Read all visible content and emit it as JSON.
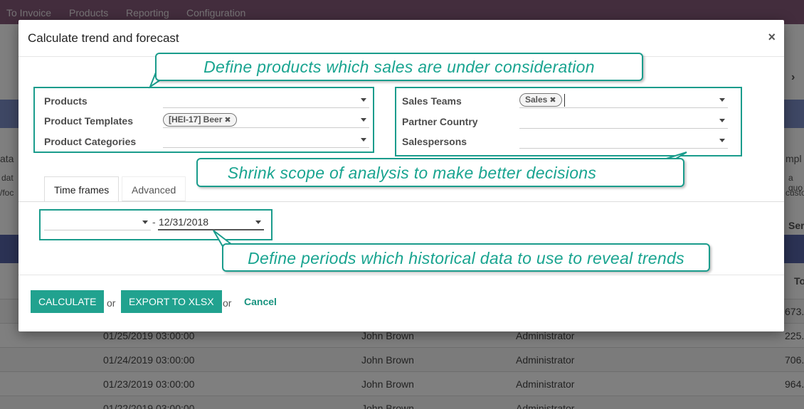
{
  "topbar": {
    "menu": [
      "To Invoice",
      "Products",
      "Reporting",
      "Configuration"
    ]
  },
  "background": {
    "left_side": [
      "ata",
      "dat",
      "/foc"
    ],
    "right_side": [
      "mpl",
      "a quo",
      "custo",
      "Ser",
      "To"
    ],
    "rows": [
      {
        "date": "",
        "customer": "",
        "user": "",
        "amount": "673."
      },
      {
        "date": "01/25/2019 03:00:00",
        "customer": "John Brown",
        "user": "Administrator",
        "amount": "225."
      },
      {
        "date": "01/24/2019 03:00:00",
        "customer": "John Brown",
        "user": "Administrator",
        "amount": "706."
      },
      {
        "date": "01/23/2019 03:00:00",
        "customer": "John Brown",
        "user": "Administrator",
        "amount": "964."
      },
      {
        "date": "01/22/2019 03:00:00",
        "customer": "John Brown",
        "user": "Administrator",
        "amount": ""
      }
    ]
  },
  "modal": {
    "title": "Calculate trend and forecast",
    "close": "×",
    "left_fields": {
      "products_label": "Products",
      "templates_label": "Product Templates",
      "templates_tag": "[HEI-17] Beer",
      "categories_label": "Product Categories"
    },
    "right_fields": {
      "teams_label": "Sales Teams",
      "teams_tag": "Sales",
      "country_label": "Partner Country",
      "salespersons_label": "Salespersons"
    },
    "tabs": {
      "time_frames": "Time frames",
      "advanced": "Advanced"
    },
    "dates": {
      "separator": "-",
      "date_to": "12/31/2018"
    },
    "footer": {
      "calculate": "CALCULATE",
      "or1": "or",
      "export": "EXPORT TO XLSX",
      "or2": "or",
      "cancel": "Cancel"
    }
  },
  "callouts": {
    "products": "Define products which sales are under consideration",
    "scope": "Shrink scope of analysis to make better decisions",
    "periods": "Define periods which historical data to use to reveal trends"
  },
  "colors": {
    "accent": "#1a9c8c",
    "button": "#21a28f",
    "topbar": "#875a7b"
  }
}
